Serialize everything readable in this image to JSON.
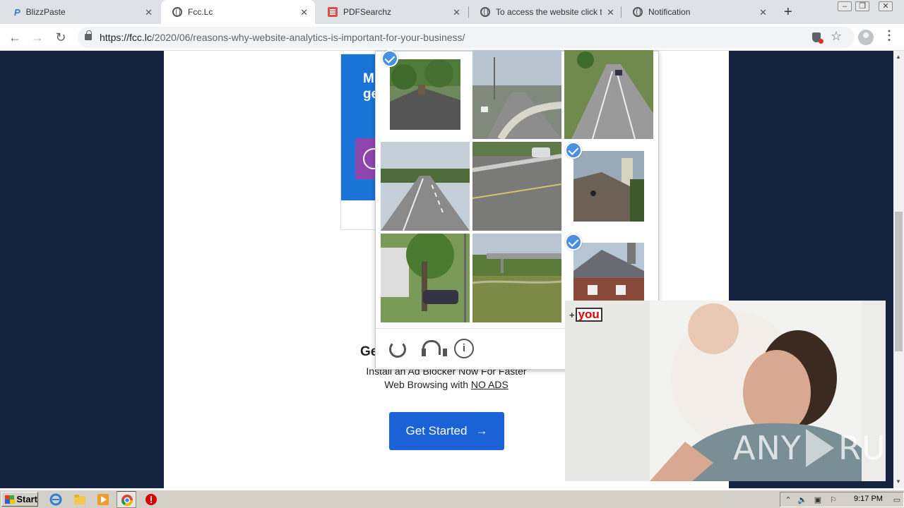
{
  "browser": {
    "tabs": [
      {
        "title": "BlizzPaste",
        "icon": "p-logo-icon",
        "close": "✕"
      },
      {
        "title": "Fcc.Lc",
        "icon": "globe-icon",
        "close": "✕",
        "active": true
      },
      {
        "title": "PDFSearchz",
        "icon": "pdf-icon",
        "close": "✕"
      },
      {
        "title": "To access the website click the",
        "icon": "globe-icon",
        "close": "✕"
      },
      {
        "title": "Notification",
        "icon": "globe-icon",
        "close": "✕"
      }
    ],
    "new_tab": "+",
    "url_host": "https://fcc.lc",
    "url_path": "/2020/06/reasons-why-website-analytics-is-important-for-your-business/"
  },
  "page": {
    "ad_blue_text": "M ge",
    "heading_partial": "Ge",
    "adblock_line1": "Install an Ad Blocker Now For Faster",
    "adblock_line2": "Web Browsing with",
    "adblock_link": "NO ADS",
    "cta_label": "Get Started",
    "cta_arrow": "→"
  },
  "captcha": {
    "tiles": [
      {
        "scene": "roof-house",
        "selected": true
      },
      {
        "scene": "highway-overpass",
        "selected": false
      },
      {
        "scene": "road-lane-markings",
        "selected": false
      },
      {
        "scene": "road-lane",
        "selected": false
      },
      {
        "scene": "highway-guardrail",
        "selected": false
      },
      {
        "scene": "house-chimney",
        "selected": true
      },
      {
        "scene": "tree-garage",
        "selected": false
      },
      {
        "scene": "bridge-grass",
        "selected": false
      },
      {
        "scene": "brick-house",
        "selected": true
      }
    ],
    "info_glyph": "i"
  },
  "video_ad": {
    "brand_plus": "+",
    "brand": "you",
    "watermark_left": "ANY",
    "watermark_right": "RUN"
  },
  "taskbar": {
    "start_label": "Start",
    "clock": "9:17 PM"
  },
  "colors": {
    "page_bg": "#162441",
    "cta": "#1a62d6",
    "check": "#4a90e2",
    "ad_blue": "#1a73d6"
  }
}
